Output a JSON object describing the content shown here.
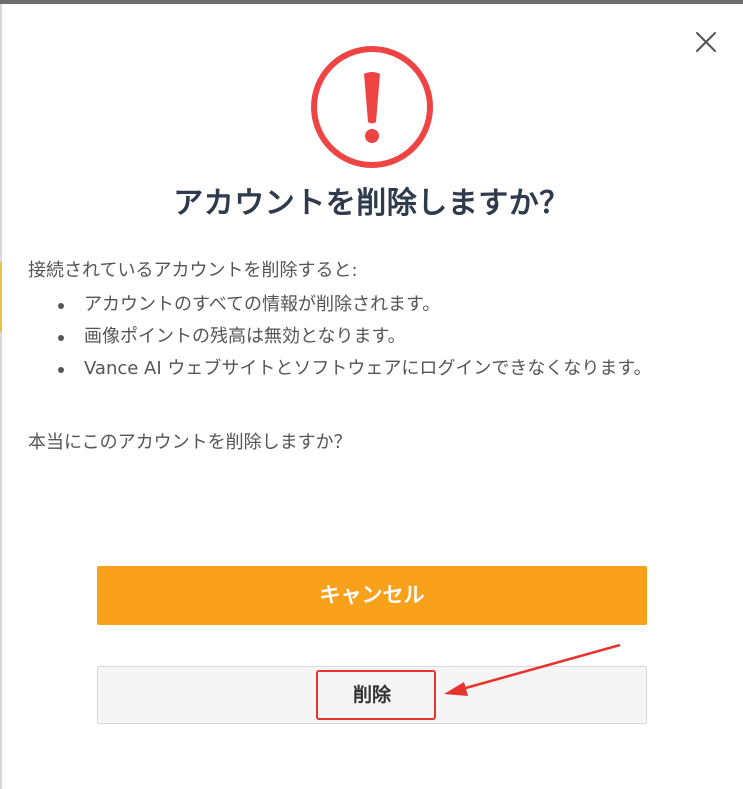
{
  "dialog": {
    "title": "アカウントを削除しますか？",
    "intro": "接続されているアカウントを削除すると:",
    "bullets": [
      "アカウントのすべての情報が削除されます。",
      "画像ポイントの残高は無効となります。",
      "Vance AI ウェブサイトとソフトウェアにログインできなくなります。"
    ],
    "confirm_question": "本当にこのアカウントを削除しますか？",
    "cancel_label": "キャンセル",
    "delete_label": "削除"
  },
  "icons": {
    "warning": "exclamation-circle-icon",
    "close": "close-icon"
  },
  "colors": {
    "warning_red": "#ef4444",
    "title_text": "#2f3a4c",
    "cancel_orange": "#f9a11b",
    "annotation_red": "#e8332e"
  }
}
